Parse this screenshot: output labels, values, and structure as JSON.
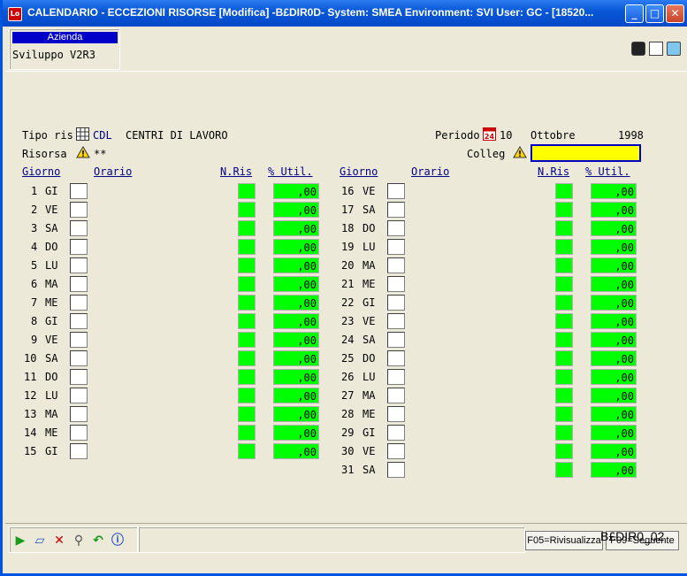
{
  "window": {
    "title": "CALENDARIO - ECCEZIONI RISORSE [Modifica] -B£DIR0D- System: SMEA Environment: SVI User: GC - [18520...",
    "minimize": "_",
    "maximize": "□",
    "close": "✕"
  },
  "azienda": {
    "header": "Azienda",
    "value": "Sviluppo V2R3"
  },
  "form": {
    "tipo_ris_label": "Tipo ris",
    "tipo_ris_code": "CDL",
    "tipo_ris_desc": "CENTRI DI LAVORO",
    "risorsa_label": "Risorsa",
    "risorsa_value": "**",
    "periodo_label": "Periodo",
    "periodo_month_num": "10",
    "periodo_month_name": "Ottobre",
    "periodo_year": "1998",
    "colleg_label": "Colleg",
    "colleg_value": ""
  },
  "columns": {
    "giorno": "Giorno",
    "orario": "Orario",
    "nris": "N.Ris",
    "util": "% Util."
  },
  "days_left": [
    {
      "n": "1",
      "d": "GI",
      "util": ",00"
    },
    {
      "n": "2",
      "d": "VE",
      "util": ",00"
    },
    {
      "n": "3",
      "d": "SA",
      "util": ",00"
    },
    {
      "n": "4",
      "d": "DO",
      "util": ",00"
    },
    {
      "n": "5",
      "d": "LU",
      "util": ",00"
    },
    {
      "n": "6",
      "d": "MA",
      "util": ",00"
    },
    {
      "n": "7",
      "d": "ME",
      "util": ",00"
    },
    {
      "n": "8",
      "d": "GI",
      "util": ",00"
    },
    {
      "n": "9",
      "d": "VE",
      "util": ",00"
    },
    {
      "n": "10",
      "d": "SA",
      "util": ",00"
    },
    {
      "n": "11",
      "d": "DO",
      "util": ",00"
    },
    {
      "n": "12",
      "d": "LU",
      "util": ",00"
    },
    {
      "n": "13",
      "d": "MA",
      "util": ",00"
    },
    {
      "n": "14",
      "d": "ME",
      "util": ",00"
    },
    {
      "n": "15",
      "d": "GI",
      "util": ",00"
    }
  ],
  "days_right": [
    {
      "n": "16",
      "d": "VE",
      "util": ",00"
    },
    {
      "n": "17",
      "d": "SA",
      "util": ",00"
    },
    {
      "n": "18",
      "d": "DO",
      "util": ",00"
    },
    {
      "n": "19",
      "d": "LU",
      "util": ",00"
    },
    {
      "n": "20",
      "d": "MA",
      "util": ",00"
    },
    {
      "n": "21",
      "d": "ME",
      "util": ",00"
    },
    {
      "n": "22",
      "d": "GI",
      "util": ",00"
    },
    {
      "n": "23",
      "d": "VE",
      "util": ",00"
    },
    {
      "n": "24",
      "d": "SA",
      "util": ",00"
    },
    {
      "n": "25",
      "d": "DO",
      "util": ",00"
    },
    {
      "n": "26",
      "d": "LU",
      "util": ",00"
    },
    {
      "n": "27",
      "d": "MA",
      "util": ",00"
    },
    {
      "n": "28",
      "d": "ME",
      "util": ",00"
    },
    {
      "n": "29",
      "d": "GI",
      "util": ",00"
    },
    {
      "n": "30",
      "d": "VE",
      "util": ",00"
    },
    {
      "n": "31",
      "d": "SA",
      "util": ",00"
    }
  ],
  "footer": {
    "f05": "F05=Rivisualizza",
    "f09": "F09=Seguente",
    "program_code": "B£DIR0_02"
  },
  "colors": {
    "green": "#00ff00",
    "yellow": "#ffff00",
    "title_blue": "#0a58d6"
  }
}
